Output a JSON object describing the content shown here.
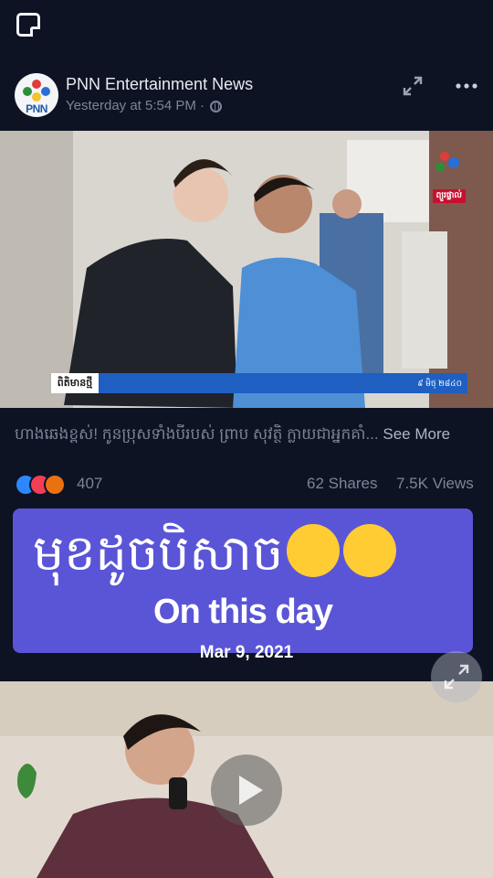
{
  "post": {
    "page_name": "PNN Entertainment News",
    "timestamp": "Yesterday at 5:54 PM · ",
    "avatar_text": "PNN",
    "caption": "ហាងឆេងខ្ពស់! កូនប្រុសទាំងបីរបស់ ព្រាប សុវត្ថិ ក្លាយជាអ្នកគាំ...",
    "see_more": "See More",
    "reaction_count": "407",
    "shares": "62 Shares",
    "views": "7.5K Views",
    "image_ticker_tag": "ពិតិមានថ្មី",
    "image_ticker_date": "៩ មិថុ ២៨៤០",
    "image_channel_tag": "ព្យួរផ្ទាល់",
    "icons": [
      "new-post-icon",
      "globe-icon",
      "expand-icon",
      "more-icon",
      "like-reaction-icon",
      "love-reaction-icon",
      "angry-reaction-icon",
      "play-icon",
      "fullscreen-icon"
    ]
  },
  "memory": {
    "khmer_title": "មុខដូចបិសាច",
    "label": "On this day",
    "date": "Mar 9, 2021"
  },
  "colors": {
    "background": "#0d1323",
    "card": "#5a55d6",
    "muted_text": "#7c8498"
  }
}
